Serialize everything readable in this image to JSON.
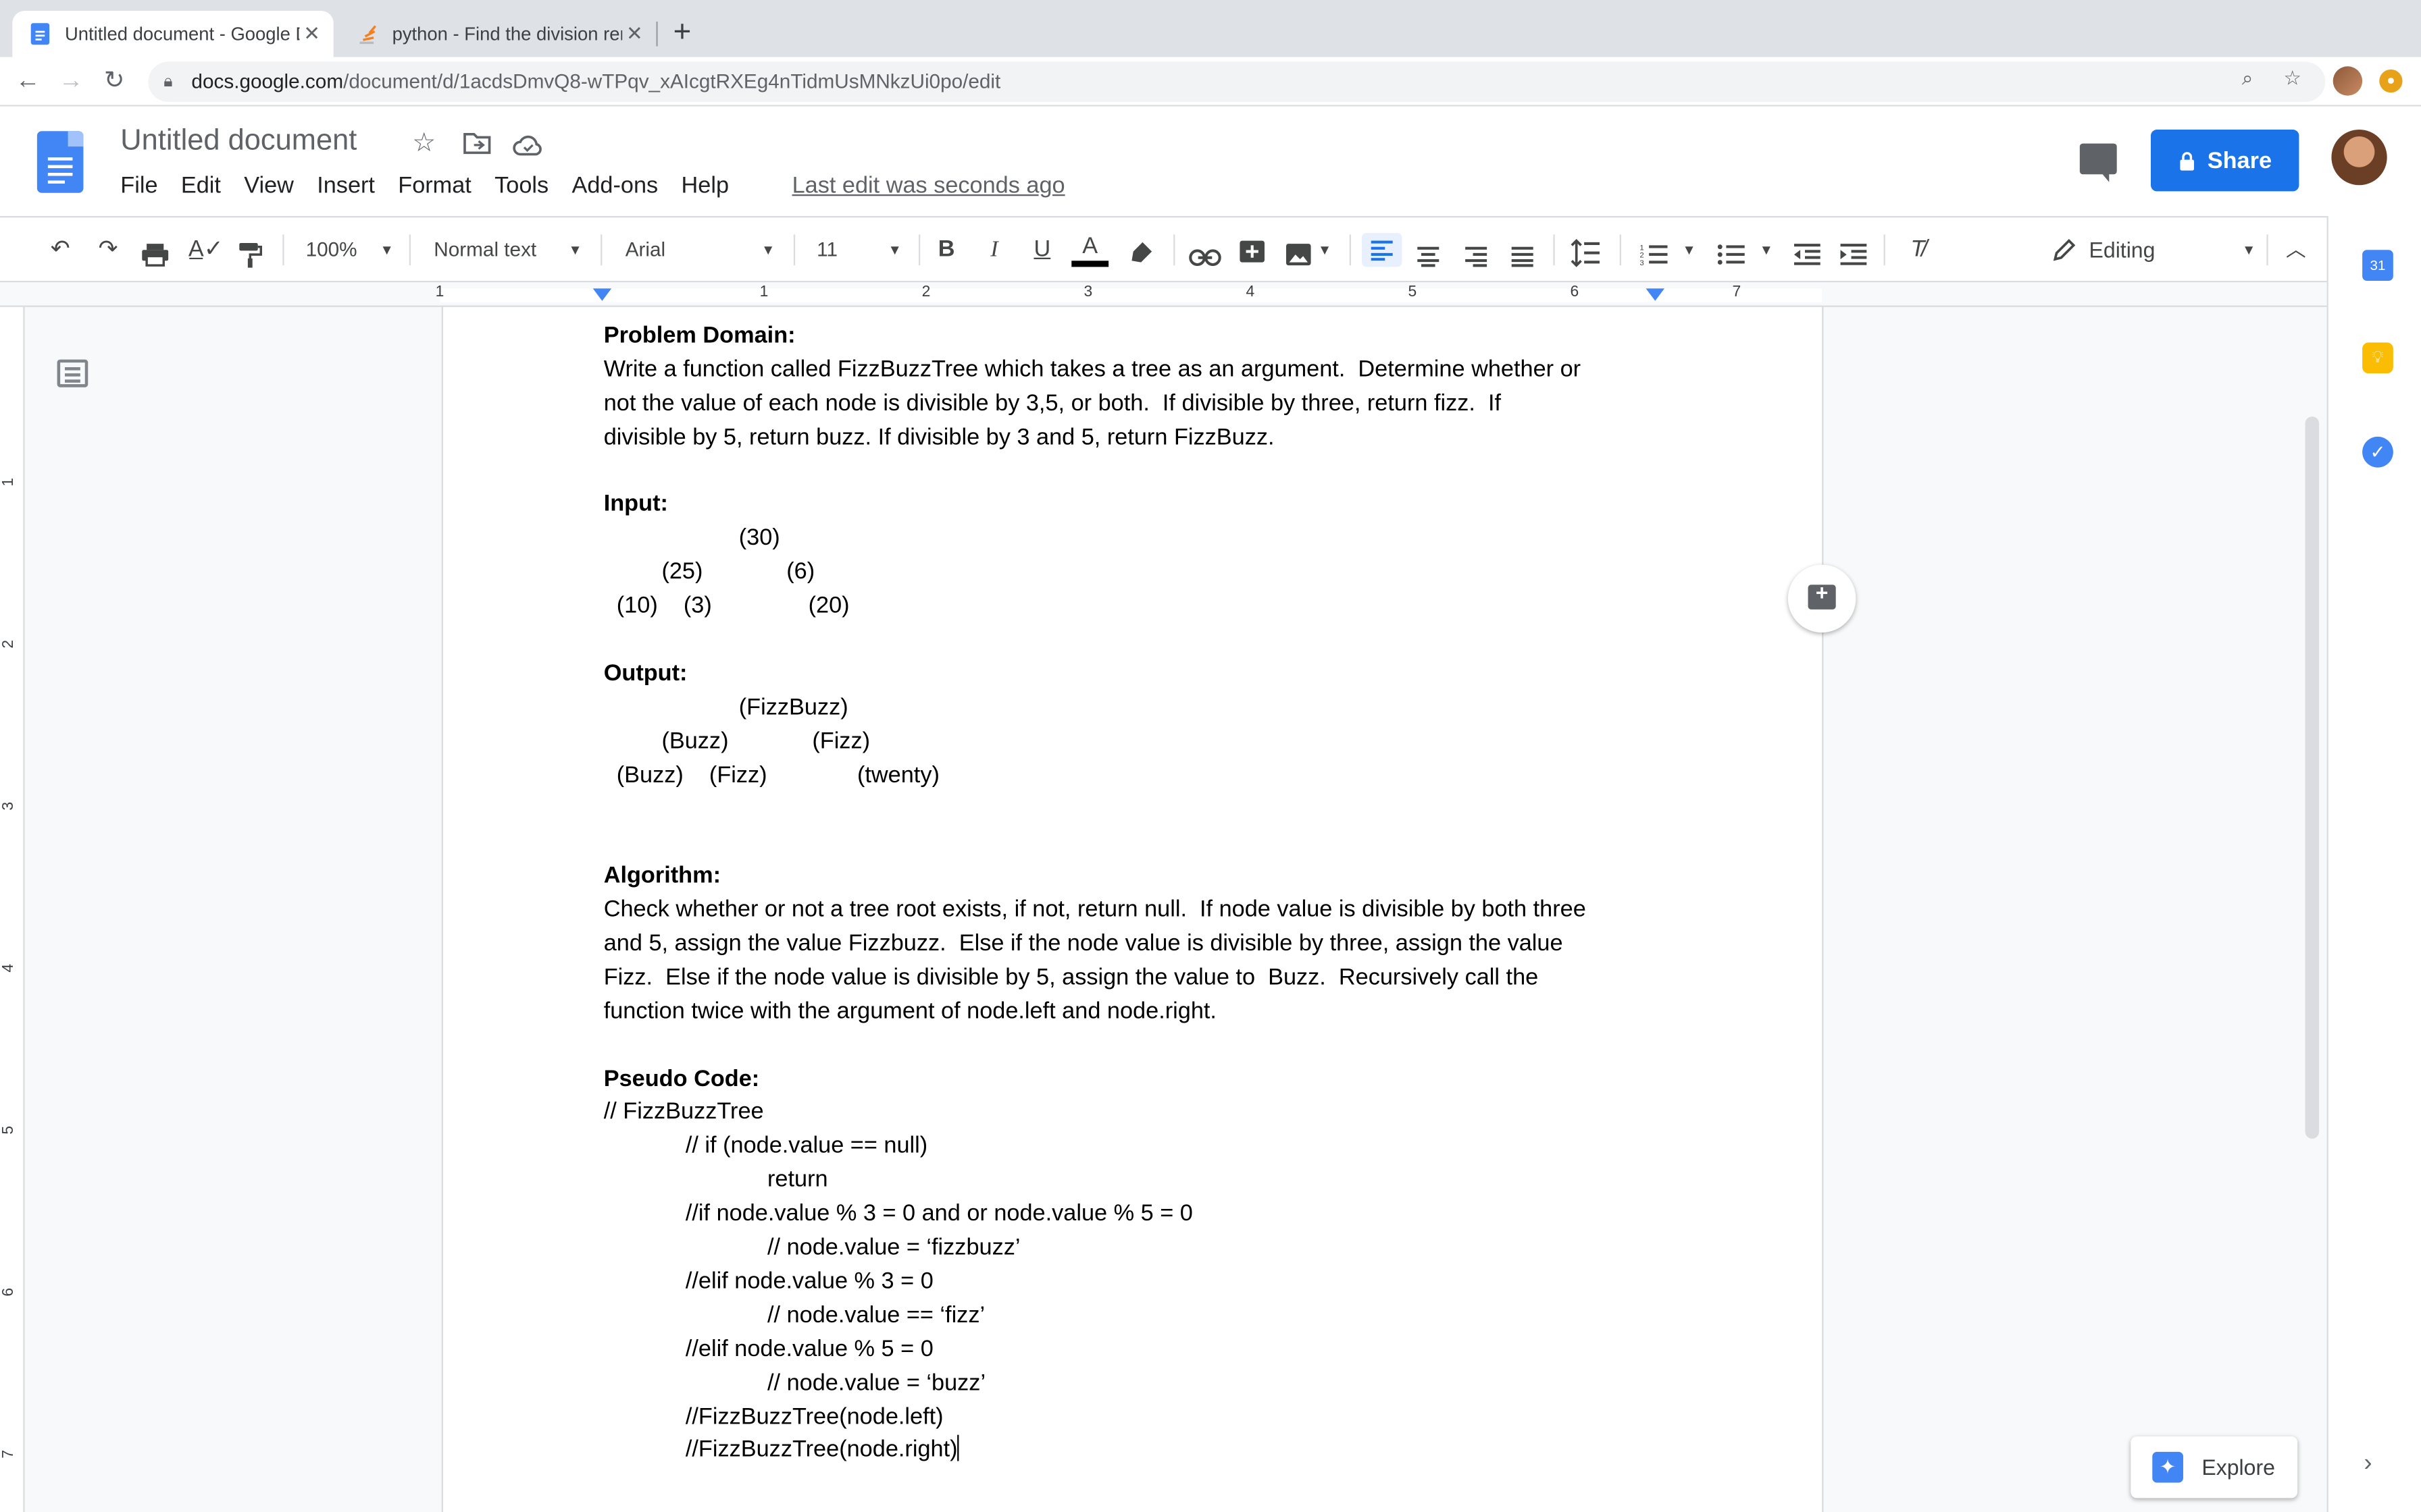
{
  "browser": {
    "tabs": [
      {
        "title": "Untitled document - Google Do",
        "active": true,
        "icon": "google-docs-icon"
      },
      {
        "title": "python - Find the division rema",
        "active": false,
        "icon": "stackoverflow-icon"
      }
    ],
    "new_tab_label": "+",
    "close_label": "✕",
    "url_host": "docs.google.com",
    "url_path": "/document/d/1acdsDmvQ8-wTPqv_xAIcgtRXEg4nTidmUsMNkzUi0po/edit"
  },
  "docs": {
    "title": "Untitled document",
    "menu": [
      "File",
      "Edit",
      "View",
      "Insert",
      "Format",
      "Tools",
      "Add-ons",
      "Help"
    ],
    "last_edit": "Last edit was seconds ago",
    "share_label": "Share"
  },
  "toolbar": {
    "zoom": "100%",
    "style": "Normal text",
    "font": "Arial",
    "font_size": "11",
    "mode": "Editing",
    "active_align": "left"
  },
  "ruler": {
    "labels": [
      "1",
      "1",
      "2",
      "3",
      "4",
      "5",
      "6",
      "7"
    ]
  },
  "vruler": {
    "labels": [
      "1",
      "2",
      "3",
      "4",
      "5",
      "6",
      "7"
    ]
  },
  "document": {
    "lines": [
      {
        "text": "Problem Domain:",
        "bold": true,
        "indent": 0
      },
      {
        "text": "Write a function called FizzBuzzTree which takes a tree as an argument.  Determine whether or",
        "bold": false,
        "indent": 0
      },
      {
        "text": "not the value of each node is divisible by 3,5, or both.  If divisible by three, return fizz.  If",
        "bold": false,
        "indent": 0
      },
      {
        "text": "divisible by 5, return buzz. If divisible by 3 and 5, return FizzBuzz.",
        "bold": false,
        "indent": 0
      },
      {
        "text": "",
        "bold": false,
        "indent": 0
      },
      {
        "text": "Input:",
        "bold": true,
        "indent": 0
      },
      {
        "text": "                     (30)",
        "bold": false,
        "indent": 0
      },
      {
        "text": "         (25)             (6)",
        "bold": false,
        "indent": 0
      },
      {
        "text": "  (10)    (3)               (20)",
        "bold": false,
        "indent": 0
      },
      {
        "text": "",
        "bold": false,
        "indent": 0
      },
      {
        "text": "Output:",
        "bold": true,
        "indent": 0
      },
      {
        "text": "                     (FizzBuzz)",
        "bold": false,
        "indent": 0
      },
      {
        "text": "         (Buzz)             (Fizz)",
        "bold": false,
        "indent": 0
      },
      {
        "text": "  (Buzz)    (Fizz)              (twenty)",
        "bold": false,
        "indent": 0
      },
      {
        "text": "",
        "bold": false,
        "indent": 0
      },
      {
        "text": "",
        "bold": false,
        "indent": 0
      },
      {
        "text": "Algorithm:",
        "bold": true,
        "indent": 0
      },
      {
        "text": "Check whether or not a tree root exists, if not, return null.  If node value is divisible by both three",
        "bold": false,
        "indent": 0
      },
      {
        "text": "and 5, assign the value Fizzbuzz.  Else if the node value is divisible by three, assign the value",
        "bold": false,
        "indent": 0
      },
      {
        "text": "Fizz.  Else if the node value is divisible by 5, assign the value to  Buzz.  Recursively call the",
        "bold": false,
        "indent": 0
      },
      {
        "text": "function twice with the argument of node.left and node.right.",
        "bold": false,
        "indent": 0
      },
      {
        "text": "",
        "bold": false,
        "indent": 0
      },
      {
        "text": "Pseudo Code:",
        "bold": true,
        "indent": 0
      },
      {
        "text": "// FizzBuzzTree",
        "bold": false,
        "indent": 0
      },
      {
        "text": "// if (node.value == null)",
        "bold": false,
        "indent": 1
      },
      {
        "text": "return",
        "bold": false,
        "indent": 2
      },
      {
        "text": "//if node.value % 3 = 0 and or node.value % 5 = 0",
        "bold": false,
        "indent": 1
      },
      {
        "text": "// node.value = ‘fizzbuzz’",
        "bold": false,
        "indent": 2
      },
      {
        "text": "//elif node.value % 3 = 0",
        "bold": false,
        "indent": 1
      },
      {
        "text": "// node.value == ‘fizz’",
        "bold": false,
        "indent": 2
      },
      {
        "text": "//elif node.value % 5 = 0",
        "bold": false,
        "indent": 1
      },
      {
        "text": "// node.value = ‘buzz’",
        "bold": false,
        "indent": 2
      },
      {
        "text": "//FizzBuzzTree(node.left)",
        "bold": false,
        "indent": 1
      },
      {
        "text": "//FizzBuzzTree(node.right)",
        "bold": false,
        "indent": 1
      }
    ]
  },
  "explore_label": "Explore",
  "colors": {
    "accent": "#1a73e8",
    "docs_blue": "#4285f4"
  }
}
